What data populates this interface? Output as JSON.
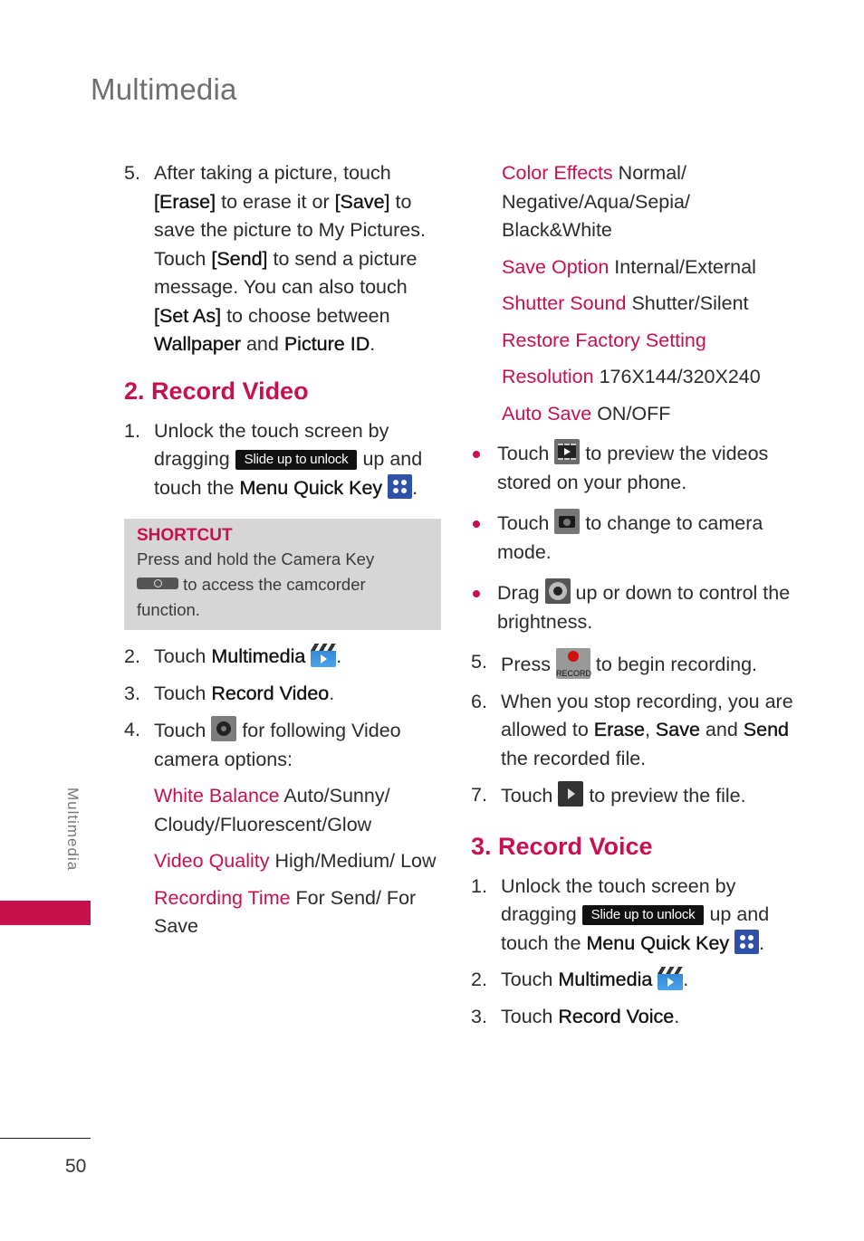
{
  "header": {
    "title": "Multimedia"
  },
  "side": {
    "label": "Multimedia",
    "tab_color": "#c8104c"
  },
  "footer": {
    "page_number": "50"
  },
  "colors": {
    "accent": "#c8104c"
  },
  "left": {
    "step5": {
      "num": "5.",
      "t1": "After taking a picture, touch ",
      "erase": "[Erase]",
      "t2": " to erase it or ",
      "save": "[Save]",
      "t3": " to save the picture to My Pictures. Touch ",
      "send": "[Send]",
      "t4": " to send a picture message. You can also touch ",
      "setas": "[Set As]",
      "t5": " to choose between ",
      "wallpaper": "Wallpaper",
      "t6": " and ",
      "pictureid": "Picture ID",
      "t7": "."
    },
    "section_title": "2. Record Video",
    "step1": {
      "num": "1.",
      "t1": "Unlock the touch screen by dragging ",
      "slide": "Slide up to unlock",
      "t2": " up and touch the ",
      "menu": "Menu Quick Key",
      "t3": "."
    },
    "shortcut": {
      "title": "SHORTCUT",
      "line1": "Press and hold the Camera Key",
      "line2": " to access the camcorder function."
    },
    "step2": {
      "num": "2.",
      "t1": "Touch ",
      "b": "Multimedia",
      "t2": "."
    },
    "step3": {
      "num": "3.",
      "t1": "Touch ",
      "b": "Record Video",
      "t2": "."
    },
    "step4": {
      "num": "4.",
      "t1": "Touch ",
      "t2": " for following Video camera options:"
    },
    "options": [
      {
        "name": "White Balance",
        "value": " Auto/Sunny/ Cloudy/Fluorescent/Glow"
      },
      {
        "name": "Video Quality",
        "value": " High/Medium/ Low"
      },
      {
        "name": "Recording Time",
        "value": " For Send/ For Save"
      }
    ]
  },
  "right": {
    "options": [
      {
        "name": "Color Effects",
        "value": " Normal/ Negative/Aqua/Sepia/ Black&White"
      },
      {
        "name": "Save Option",
        "value": " Internal/External"
      },
      {
        "name": "Shutter Sound",
        "value": " Shutter/Silent"
      },
      {
        "name": "Restore Factory Setting",
        "value": ""
      },
      {
        "name": "Resolution",
        "value": " 176X144/320X240"
      },
      {
        "name": "Auto Save",
        "value": " ON/OFF"
      }
    ],
    "bullets": [
      {
        "t1": "Touch ",
        "t2": " to preview the videos stored on your phone."
      },
      {
        "t1": "Touch ",
        "t2": " to change to camera mode."
      },
      {
        "t1": "Drag ",
        "t2": " up or down to control the brightness."
      }
    ],
    "record_label": "RECORD",
    "step5": {
      "num": "5.",
      "t1": "Press ",
      "t2": " to begin recording."
    },
    "step6": {
      "num": "6.",
      "t1": "When you stop recording, you are allowed to ",
      "erase": "Erase",
      "comma": ", ",
      "save": "Save",
      "t2": " and ",
      "send": "Send",
      "t3": " the recorded file."
    },
    "step7": {
      "num": "7.",
      "t1": "Touch ",
      "t2": " to preview the file."
    },
    "section_title": "3. Record Voice",
    "v1": {
      "num": "1.",
      "t1": "Unlock the touch screen by dragging ",
      "slide": "Slide up to unlock",
      "t2": " up and touch the ",
      "menu": "Menu Quick Key",
      "t3": "."
    },
    "v2": {
      "num": "2.",
      "t1": "Touch ",
      "b": "Multimedia",
      "t2": "."
    },
    "v3": {
      "num": "3.",
      "t1": "Touch ",
      "b": "Record Voice",
      "t2": "."
    }
  }
}
